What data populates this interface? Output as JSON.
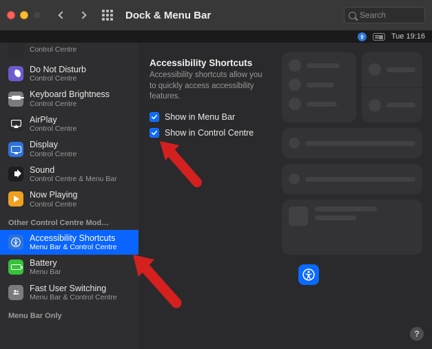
{
  "window": {
    "title": "Dock & Menu Bar"
  },
  "search": {
    "placeholder": "Search"
  },
  "menubar": {
    "clock": "Tue 19:16"
  },
  "sidebar": {
    "items": [
      {
        "title": "",
        "sub": "Control Centre"
      },
      {
        "title": "Do Not Disturb",
        "sub": "Control Centre"
      },
      {
        "title": "Keyboard Brightness",
        "sub": "Control Centre"
      },
      {
        "title": "AirPlay",
        "sub": "Control Centre"
      },
      {
        "title": "Display",
        "sub": "Control Centre"
      },
      {
        "title": "Sound",
        "sub": "Control Centre & Menu Bar"
      },
      {
        "title": "Now Playing",
        "sub": "Control Centre"
      }
    ],
    "section_other": "Other Control Centre Mod…",
    "other_items": [
      {
        "title": "Accessibility Shortcuts",
        "sub": "Menu Bar & Control Centre"
      },
      {
        "title": "Battery",
        "sub": "Menu Bar"
      },
      {
        "title": "Fast User Switching",
        "sub": "Menu Bar & Control Centre"
      }
    ],
    "section_menubar_only": "Menu Bar Only"
  },
  "detail": {
    "heading": "Accessibility Shortcuts",
    "desc": "Accessibility shortcuts allow you to quickly access accessibility features.",
    "check1": "Show in Menu Bar",
    "check2": "Show in Control Centre"
  },
  "help": {
    "label": "?"
  }
}
